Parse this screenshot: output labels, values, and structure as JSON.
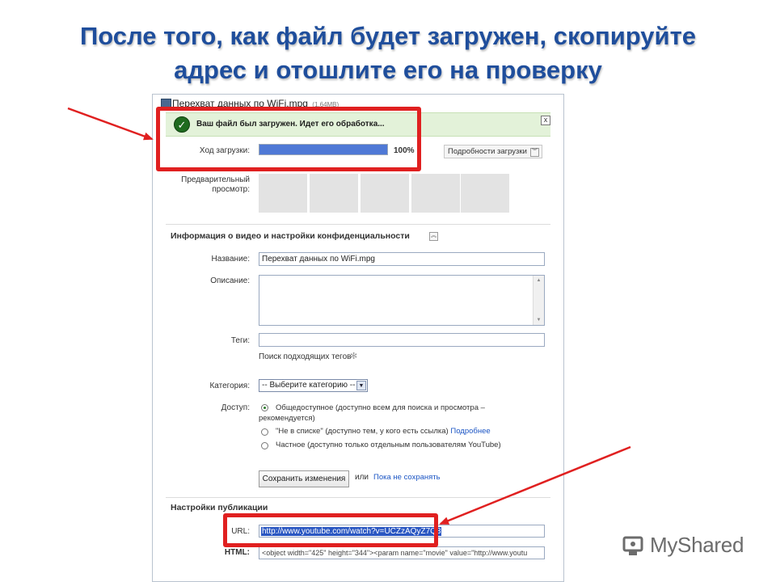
{
  "slide": {
    "title_line1": "После того, как файл будет загружен, скопируйте",
    "title_line2": "адрес и отошлите его на проверку"
  },
  "upload": {
    "file_name": "Перехват данных по WiFi.mpg",
    "file_size": "(1.64MB)",
    "success_message": "Ваш файл был загружен. Идет его обработка...",
    "close_label": "x",
    "progress_label": "Ход загрузки:",
    "progress_value": "100%",
    "progress_fraction": 1.0,
    "details_button": "Подробности загрузки",
    "preview_label_1": "Предварительный",
    "preview_label_2": "просмотр:"
  },
  "video_info": {
    "section_title": "Информация о видео и настройки конфиденциальности",
    "title_label": "Название:",
    "title_value": "Перехват данных по WiFi.mpg",
    "description_label": "Описание:",
    "tags_label": "Теги:",
    "tag_search": "Поиск подходящих тегов",
    "category_label": "Категория:",
    "category_value": "-- Выберите категорию --",
    "access_label": "Доступ:",
    "access_public_1": "Общедоступное (доступно всем для поиска и просмотра –",
    "access_public_2": "рекомендуется)",
    "access_unlisted": "\"Не в списке\" (доступно тем, у кого есть ссылка)",
    "access_more_link": "Подробнее",
    "access_private": "Частное (доступно только отдельным пользователям YouTube)",
    "save_button": "Сохранить изменения",
    "or_text": "или",
    "not_save_link": "Пока не сохранять"
  },
  "publish": {
    "section_title": "Настройки публикации",
    "url_label": "URL:",
    "url_value": "http://www.youtube.com/watch?v=UCZzAQyZ7Q8",
    "html_label": "HTML:",
    "html_value": "<object width=\"425\" height=\"344\"><param name=\"movie\" value=\"http://www.youtu"
  },
  "watermark": {
    "text": "MyShared"
  },
  "colors": {
    "title": "#1f4e9c",
    "highlight_red": "#e02020",
    "progress_fill": "#4f79d6",
    "success_bg": "#e3f2d9"
  }
}
